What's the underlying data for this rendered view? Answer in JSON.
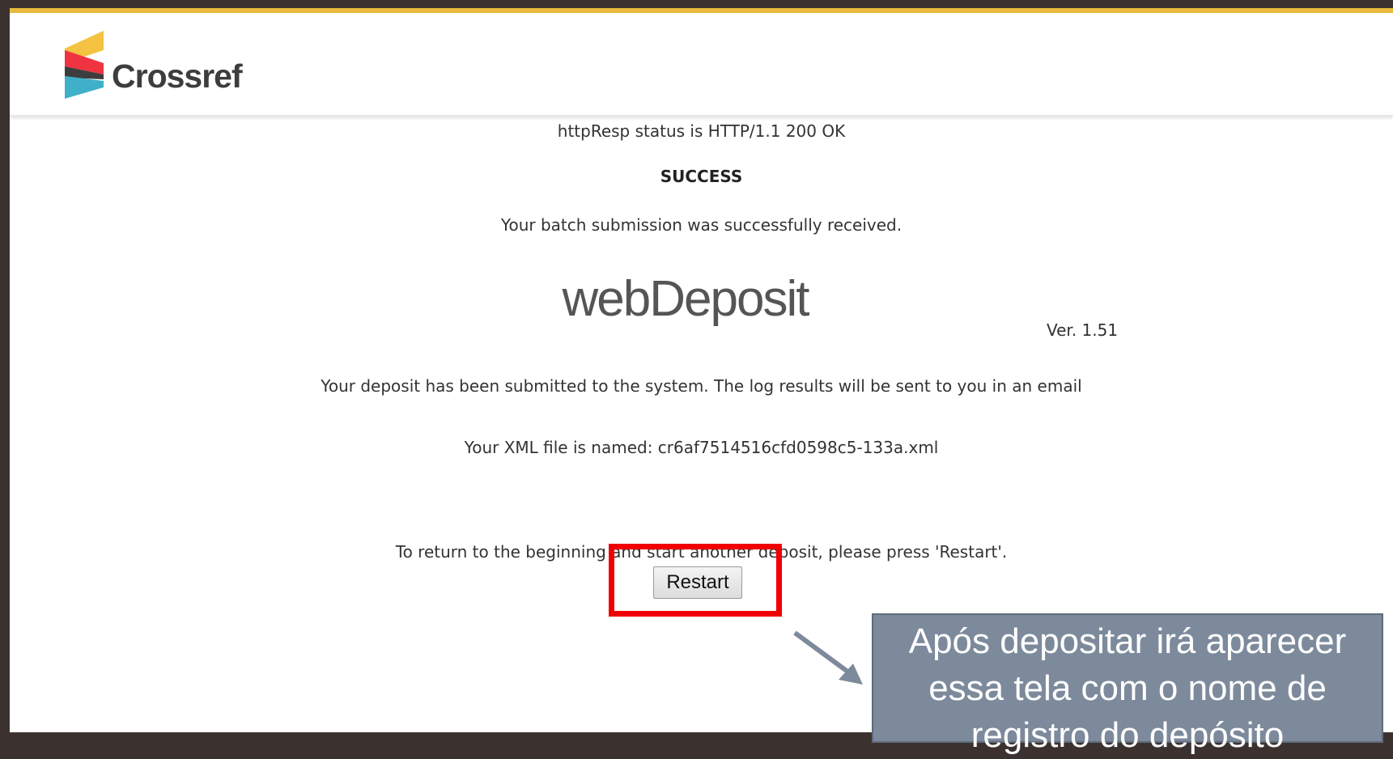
{
  "header": {
    "logo_text": "Crossref"
  },
  "response": {
    "status_line": "httpResp status is HTTP/1.1 200 OK",
    "result": "SUCCESS",
    "batch_message": "Your batch submission was successfully received."
  },
  "app": {
    "brand": "webDeposit",
    "version": "Ver. 1.51"
  },
  "deposit": {
    "message": "Your deposit has been submitted to the system. The log results will be sent to you in an email",
    "xml_label": "Your XML file is named: cr6af7514516cfd0598c5-133a.xml",
    "restart_prompt": "To return to the beginning and start another deposit, please press 'Restart'.",
    "restart_label": "Restart"
  },
  "annotation": {
    "callout_text": "Após depositar irá aparecer essa tela com o nome de registro do depósito",
    "highlight_color": "#f00000",
    "callout_color": "#7d8a9c"
  },
  "colors": {
    "accent_bar": "#e8b93a",
    "frame": "#3b3230"
  }
}
